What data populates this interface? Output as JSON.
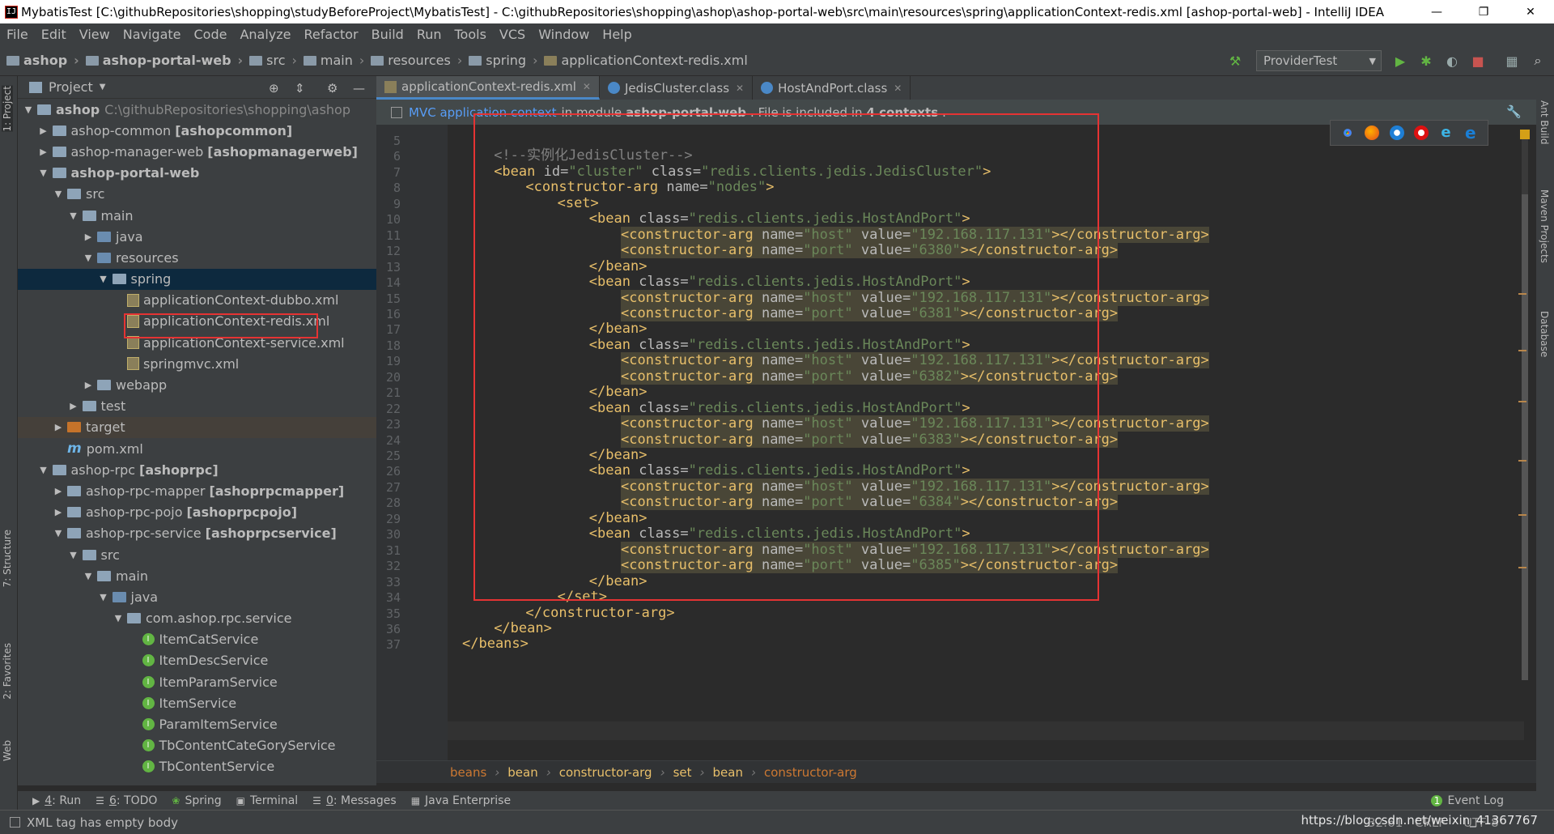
{
  "window": {
    "title": "MybatisTest [C:\\githubRepositories\\shopping\\studyBeforeProject\\MybatisTest] - C:\\githubRepositories\\shopping\\ashop\\ashop-portal-web\\src\\main\\resources\\spring\\applicationContext-redis.xml [ashop-portal-web] - IntelliJ IDEA",
    "app_icon": "IJ",
    "minimize": "—",
    "maximize": "❐",
    "close": "✕"
  },
  "menu": [
    "File",
    "Edit",
    "View",
    "Navigate",
    "Code",
    "Analyze",
    "Refactor",
    "Build",
    "Run",
    "Tools",
    "VCS",
    "Window",
    "Help"
  ],
  "breadcrumbs": [
    "ashop",
    "ashop-portal-web",
    "src",
    "main",
    "resources",
    "spring",
    "applicationContext-redis.xml"
  ],
  "run_config": "ProviderTest",
  "left_strip": {
    "project": "1: Project",
    "structure": "7: Structure",
    "favorites": "2: Favorites",
    "web": "Web"
  },
  "right_strip": {
    "ant": "Ant Build",
    "maven": "Maven Projects",
    "database": "Database"
  },
  "project_panel": {
    "title": "Project",
    "tree": [
      {
        "label": "ashop",
        "path": "C:\\githubRepositories\\shopping\\ashop",
        "depth": 0,
        "arrow": "▼",
        "bold": true
      },
      {
        "label": "ashop-common",
        "module": "[ashopcommon]",
        "depth": 1,
        "arrow": "▶"
      },
      {
        "label": "ashop-manager-web",
        "module": "[ashopmanagerweb]",
        "depth": 1,
        "arrow": "▶"
      },
      {
        "label": "ashop-portal-web",
        "depth": 1,
        "arrow": "▼",
        "bold": true
      },
      {
        "label": "src",
        "depth": 2,
        "arrow": "▼"
      },
      {
        "label": "main",
        "depth": 3,
        "arrow": "▼"
      },
      {
        "label": "java",
        "depth": 4,
        "arrow": "▶"
      },
      {
        "label": "resources",
        "depth": 4,
        "arrow": "▼"
      },
      {
        "label": "spring",
        "depth": 5,
        "arrow": "▼"
      },
      {
        "label": "applicationContext-dubbo.xml",
        "depth": 6,
        "arrow": ""
      },
      {
        "label": "applicationContext-redis.xml",
        "depth": 6,
        "arrow": ""
      },
      {
        "label": "applicationContext-service.xml",
        "depth": 6,
        "arrow": ""
      },
      {
        "label": "springmvc.xml",
        "depth": 6,
        "arrow": ""
      },
      {
        "label": "webapp",
        "depth": 4,
        "arrow": "▶"
      },
      {
        "label": "test",
        "depth": 3,
        "arrow": "▶"
      },
      {
        "label": "target",
        "depth": 2,
        "arrow": "▶"
      },
      {
        "label": "pom.xml",
        "depth": 2,
        "arrow": "",
        "icon": "m"
      },
      {
        "label": "ashop-rpc",
        "module": "[ashoprpc]",
        "depth": 1,
        "arrow": "▼"
      },
      {
        "label": "ashop-rpc-mapper",
        "module": "[ashoprpcmapper]",
        "depth": 2,
        "arrow": "▶"
      },
      {
        "label": "ashop-rpc-pojo",
        "module": "[ashoprpcpojo]",
        "depth": 2,
        "arrow": "▶"
      },
      {
        "label": "ashop-rpc-service",
        "module": "[ashoprpcservice]",
        "depth": 2,
        "arrow": "▼"
      },
      {
        "label": "src",
        "depth": 3,
        "arrow": "▼"
      },
      {
        "label": "main",
        "depth": 4,
        "arrow": "▼"
      },
      {
        "label": "java",
        "depth": 5,
        "arrow": "▼"
      },
      {
        "label": "com.ashop.rpc.service",
        "depth": 6,
        "arrow": "▼"
      },
      {
        "label": "ItemCatService",
        "depth": 7,
        "arrow": "",
        "icon": "I"
      },
      {
        "label": "ItemDescService",
        "depth": 7,
        "arrow": "",
        "icon": "I"
      },
      {
        "label": "ItemParamService",
        "depth": 7,
        "arrow": "",
        "icon": "I"
      },
      {
        "label": "ItemService",
        "depth": 7,
        "arrow": "",
        "icon": "I"
      },
      {
        "label": "ParamItemService",
        "depth": 7,
        "arrow": "",
        "icon": "I"
      },
      {
        "label": "TbContentCateGoryService",
        "depth": 7,
        "arrow": "",
        "icon": "I"
      },
      {
        "label": "TbContentService",
        "depth": 7,
        "arrow": "",
        "icon": "I"
      }
    ]
  },
  "tabs": [
    {
      "label": "applicationContext-redis.xml",
      "active": true
    },
    {
      "label": "JedisCluster.class",
      "active": false
    },
    {
      "label": "HostAndPort.class",
      "active": false
    }
  ],
  "infobar": {
    "link": "MVC application context",
    "t1": "in module",
    "module": "ashop-portal-web",
    "t2": ". File is included in",
    "contexts": "4 contexts",
    "t3": "."
  },
  "code": {
    "first_line": 5,
    "caret_line": 32,
    "lines": [
      [],
      [
        [
          "cm",
          "<!--实例化JedisCluster-->"
        ]
      ],
      [
        [
          "tg",
          "<bean "
        ],
        [
          "at",
          "id="
        ],
        [
          "av",
          "\"cluster\" "
        ],
        [
          "at",
          "class="
        ],
        [
          "av",
          "\"redis.clients.jedis.JedisCluster\""
        ],
        [
          "tg",
          ">"
        ]
      ],
      [
        [
          "tg",
          "<constructor-arg "
        ],
        [
          "at",
          "name="
        ],
        [
          "av",
          "\"nodes\""
        ],
        [
          "tg",
          ">"
        ]
      ],
      [
        [
          "tg",
          "<set>"
        ]
      ],
      [
        [
          "tg",
          "<bean "
        ],
        [
          "at",
          "class="
        ],
        [
          "av",
          "\"redis.clients.jedis.HostAndPort\""
        ],
        [
          "tg",
          ">"
        ]
      ],
      [
        [
          "tg",
          "<constructor-arg "
        ],
        [
          "at",
          "name="
        ],
        [
          "av",
          "\"host\" "
        ],
        [
          "at",
          "value="
        ],
        [
          "av",
          "\"192.168.117.131\""
        ],
        [
          "tg",
          "></constructor-arg>"
        ]
      ],
      [
        [
          "tg",
          "<constructor-arg "
        ],
        [
          "at",
          "name="
        ],
        [
          "av",
          "\"port\" "
        ],
        [
          "at",
          "value="
        ],
        [
          "av",
          "\"6380\""
        ],
        [
          "tg",
          "></constructor-arg>"
        ]
      ],
      [
        [
          "tg",
          "</bean>"
        ]
      ],
      [
        [
          "tg",
          "<bean "
        ],
        [
          "at",
          "class="
        ],
        [
          "av",
          "\"redis.clients.jedis.HostAndPort\""
        ],
        [
          "tg",
          ">"
        ]
      ],
      [
        [
          "tg",
          "<constructor-arg "
        ],
        [
          "at",
          "name="
        ],
        [
          "av",
          "\"host\" "
        ],
        [
          "at",
          "value="
        ],
        [
          "av",
          "\"192.168.117.131\""
        ],
        [
          "tg",
          "></constructor-arg>"
        ]
      ],
      [
        [
          "tg",
          "<constructor-arg "
        ],
        [
          "at",
          "name="
        ],
        [
          "av",
          "\"port\" "
        ],
        [
          "at",
          "value="
        ],
        [
          "av",
          "\"6381\""
        ],
        [
          "tg",
          "></constructor-arg>"
        ]
      ],
      [
        [
          "tg",
          "</bean>"
        ]
      ],
      [
        [
          "tg",
          "<bean "
        ],
        [
          "at",
          "class="
        ],
        [
          "av",
          "\"redis.clients.jedis.HostAndPort\""
        ],
        [
          "tg",
          ">"
        ]
      ],
      [
        [
          "tg",
          "<constructor-arg "
        ],
        [
          "at",
          "name="
        ],
        [
          "av",
          "\"host\" "
        ],
        [
          "at",
          "value="
        ],
        [
          "av",
          "\"192.168.117.131\""
        ],
        [
          "tg",
          "></constructor-arg>"
        ]
      ],
      [
        [
          "tg",
          "<constructor-arg "
        ],
        [
          "at",
          "name="
        ],
        [
          "av",
          "\"port\" "
        ],
        [
          "at",
          "value="
        ],
        [
          "av",
          "\"6382\""
        ],
        [
          "tg",
          "></constructor-arg>"
        ]
      ],
      [
        [
          "tg",
          "</bean>"
        ]
      ],
      [
        [
          "tg",
          "<bean "
        ],
        [
          "at",
          "class="
        ],
        [
          "av",
          "\"redis.clients.jedis.HostAndPort\""
        ],
        [
          "tg",
          ">"
        ]
      ],
      [
        [
          "tg",
          "<constructor-arg "
        ],
        [
          "at",
          "name="
        ],
        [
          "av",
          "\"host\" "
        ],
        [
          "at",
          "value="
        ],
        [
          "av",
          "\"192.168.117.131\""
        ],
        [
          "tg",
          "></constructor-arg>"
        ]
      ],
      [
        [
          "tg",
          "<constructor-arg "
        ],
        [
          "at",
          "name="
        ],
        [
          "av",
          "\"port\" "
        ],
        [
          "at",
          "value="
        ],
        [
          "av",
          "\"6383\""
        ],
        [
          "tg",
          "></constructor-arg>"
        ]
      ],
      [
        [
          "tg",
          "</bean>"
        ]
      ],
      [
        [
          "tg",
          "<bean "
        ],
        [
          "at",
          "class="
        ],
        [
          "av",
          "\"redis.clients.jedis.HostAndPort\""
        ],
        [
          "tg",
          ">"
        ]
      ],
      [
        [
          "tg",
          "<constructor-arg "
        ],
        [
          "at",
          "name="
        ],
        [
          "av",
          "\"host\" "
        ],
        [
          "at",
          "value="
        ],
        [
          "av",
          "\"192.168.117.131\""
        ],
        [
          "tg",
          "></constructor-arg>"
        ]
      ],
      [
        [
          "tg",
          "<constructor-arg "
        ],
        [
          "at",
          "name="
        ],
        [
          "av",
          "\"port\" "
        ],
        [
          "at",
          "value="
        ],
        [
          "av",
          "\"6384\""
        ],
        [
          "tg",
          "></constructor-arg>"
        ]
      ],
      [
        [
          "tg",
          "</bean>"
        ]
      ],
      [
        [
          "tg",
          "<bean "
        ],
        [
          "at",
          "class="
        ],
        [
          "av",
          "\"redis.clients.jedis.HostAndPort\""
        ],
        [
          "tg",
          ">"
        ]
      ],
      [
        [
          "tg",
          "<constructor-arg "
        ],
        [
          "at",
          "name="
        ],
        [
          "av",
          "\"host\" "
        ],
        [
          "at",
          "value="
        ],
        [
          "av",
          "\"192.168.117.131\""
        ],
        [
          "tg",
          "></constructor-arg>"
        ]
      ],
      [
        [
          "tg",
          "<constructor-arg "
        ],
        [
          "at",
          "name="
        ],
        [
          "av",
          "\"port\" "
        ],
        [
          "at",
          "value="
        ],
        [
          "av",
          "\"6385\""
        ],
        [
          "tg",
          "></constructor-arg>"
        ]
      ],
      [
        [
          "tg",
          "</bean>"
        ]
      ],
      [
        [
          "tg",
          "</set>"
        ]
      ],
      [
        [
          "tg",
          "</constructor-arg>"
        ]
      ],
      [
        [
          "tg",
          "</bean>"
        ]
      ],
      [
        [
          "tg",
          "</beans>"
        ]
      ]
    ],
    "indents": [
      0,
      1,
      1,
      2,
      3,
      4,
      5,
      5,
      4,
      4,
      5,
      5,
      4,
      4,
      5,
      5,
      4,
      4,
      5,
      5,
      4,
      4,
      5,
      5,
      4,
      4,
      5,
      5,
      4,
      3,
      2,
      1,
      0
    ],
    "highlighted": [
      6,
      7,
      10,
      11,
      14,
      15,
      18,
      19,
      22,
      23,
      26,
      27
    ]
  },
  "editor_breadcrumb": [
    "beans",
    "bean",
    "constructor-arg",
    "set",
    "bean",
    "constructor-arg"
  ],
  "bottom_tools": [
    {
      "key": "4",
      "label": ": Run",
      "icon": "▶"
    },
    {
      "key": "6",
      "label": ": TODO",
      "icon": "☰"
    },
    {
      "key": "",
      "label": "Spring",
      "icon": "❀"
    },
    {
      "key": "",
      "label": "Terminal",
      "icon": "▣"
    },
    {
      "key": "0",
      "label": ": Messages",
      "icon": "☰"
    },
    {
      "key": "",
      "label": "Java Enterprise",
      "icon": "▦"
    }
  ],
  "event_log": "Event Log",
  "status": {
    "message": "XML tag has empty body",
    "position": "32:61",
    "line_sep": "CRLF",
    "encoding": "UTF-8"
  },
  "watermark": "https://blog.csdn.net/weixin_41367767",
  "colors": {
    "tag": "#e8bf6a",
    "attr": "#bababa",
    "value": "#6a8759",
    "comment": "#808080",
    "selection": "#0d293e",
    "highlight": "#494637",
    "redbox": "#e53333"
  }
}
